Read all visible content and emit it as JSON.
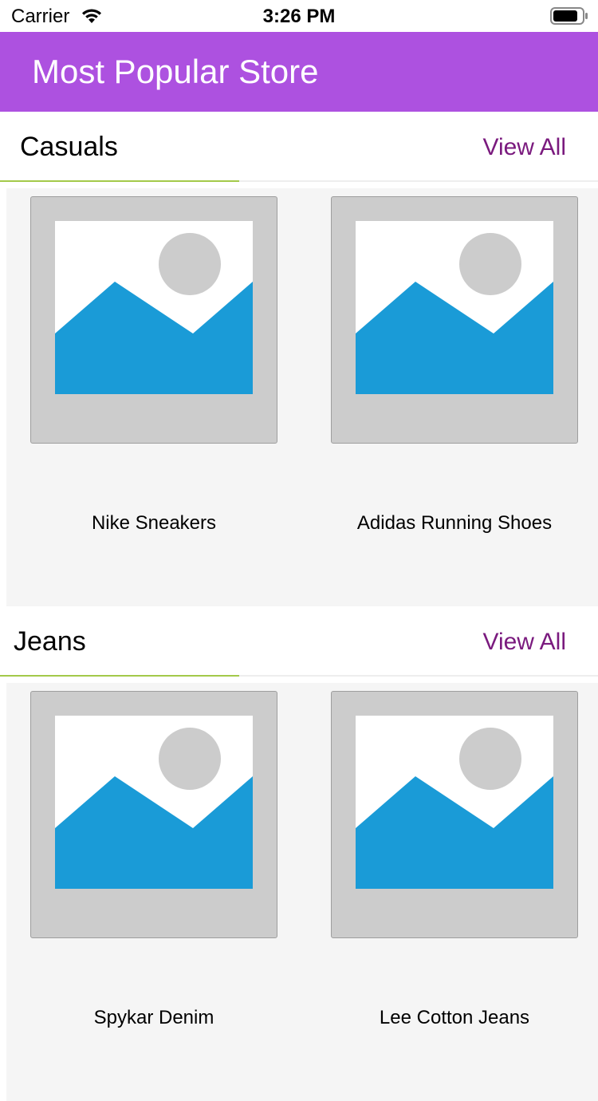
{
  "status_bar": {
    "carrier": "Carrier",
    "time": "3:26 PM",
    "wifi_icon": "wifi-icon",
    "battery_icon": "battery-icon"
  },
  "header": {
    "title": "Most Popular Store",
    "background": "#ad51e0"
  },
  "sections": [
    {
      "title": "Casuals",
      "view_all_label": "View All",
      "products": [
        {
          "name": "Nike Sneakers",
          "image_icon": "image-placeholder-icon"
        },
        {
          "name": "Adidas Running Shoes",
          "image_icon": "image-placeholder-icon"
        }
      ]
    },
    {
      "title": "Jeans",
      "view_all_label": "View All",
      "products": [
        {
          "name": "Spykar Denim",
          "image_icon": "image-placeholder-icon"
        },
        {
          "name": "Lee Cotton Jeans",
          "image_icon": "image-placeholder-icon"
        }
      ]
    }
  ],
  "colors": {
    "accent_underline": "#a3c94a",
    "view_all": "#7a1a7e",
    "card_background": "#f5f5f5",
    "placeholder_frame": "#cccccc",
    "placeholder_mountain": "#1a9bd7"
  }
}
